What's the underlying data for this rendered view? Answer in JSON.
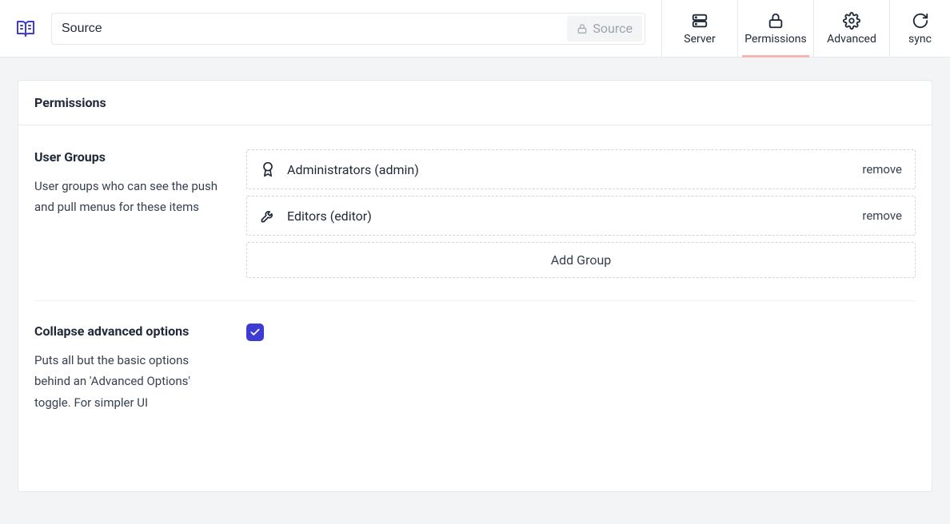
{
  "topbar": {
    "source_value": "Source",
    "locked_label": "Source"
  },
  "nav": {
    "server": "Server",
    "permissions": "Permissions",
    "advanced": "Advanced",
    "sync": "sync",
    "active": "permissions"
  },
  "panel": {
    "title": "Permissions"
  },
  "user_groups": {
    "title": "User Groups",
    "description": "User groups who can see the push and pull menus for these items",
    "groups": [
      {
        "label": "Administrators (admin)",
        "icon": "medal"
      },
      {
        "label": "Editors (editor)",
        "icon": "wrench"
      }
    ],
    "remove_label": "remove",
    "add_label": "Add Group"
  },
  "collapse": {
    "title": "Collapse advanced options",
    "description": "Puts all but the basic options behind an 'Advanced Options' toggle. For simpler UI",
    "checked": true
  }
}
